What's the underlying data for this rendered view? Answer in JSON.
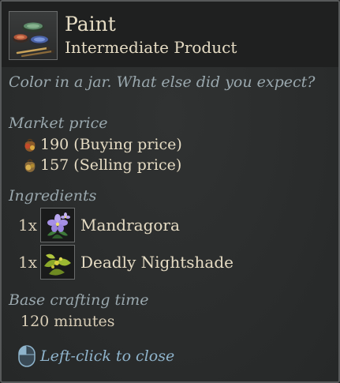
{
  "item": {
    "name": "Paint",
    "type": "Intermediate Product",
    "description": "Color in a jar. What else did you expect?",
    "icon": "paint-bowls-icon"
  },
  "market": {
    "label": "Market price",
    "buying": {
      "text": "190 (Buying price)",
      "icon": "coin-pouch-buy-icon"
    },
    "selling": {
      "text": "157 (Selling price)",
      "icon": "coin-pouch-sell-icon"
    }
  },
  "ingredients": {
    "label": "Ingredients",
    "items": [
      {
        "qty": "1x",
        "name": "Mandragora",
        "icon": "mandragora-flower-icon"
      },
      {
        "qty": "1x",
        "name": "Deadly Nightshade",
        "icon": "nightshade-plant-icon"
      }
    ]
  },
  "crafting": {
    "label": "Base crafting time",
    "value": "120 minutes"
  },
  "hint": {
    "text": "Left-click to close",
    "icon": "mouse-left-click-icon"
  },
  "colors": {
    "panel_bg": "#2a2c2c",
    "header_bg": "#1f2020",
    "border": "#57595a",
    "text_primary": "#e6dcc4",
    "text_label": "#9aa8ae",
    "text_hint": "#8fb4cc"
  }
}
